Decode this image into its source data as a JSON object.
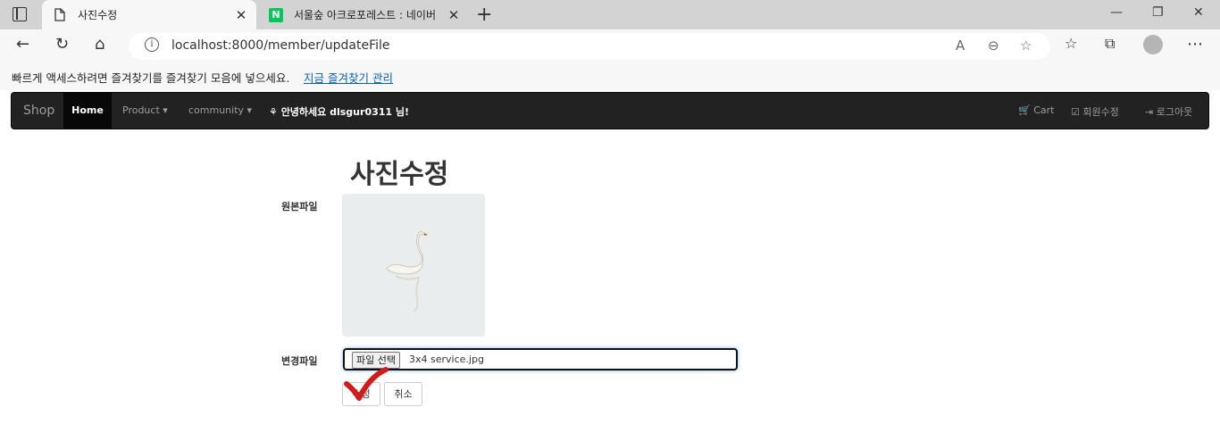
{
  "browser": {
    "tabs": [
      {
        "title": "사진수정",
        "active": true,
        "favicon": "document-icon"
      },
      {
        "title": "서울숲 아크로포레스트 : 네이버",
        "active": false,
        "favicon": "naver-icon",
        "favicon_text": "N"
      }
    ],
    "new_tab": "+",
    "window_controls": {
      "minimize": "—",
      "restore": "❐",
      "close": "✕"
    },
    "url": "localhost:8000/member/updateFile",
    "bookmarks_bar": {
      "message": "빠르게 액세스하려면 즐겨찾기를 즐겨찾기 모음에 넣으세요.",
      "link": "지금 즐겨찾기 관리"
    }
  },
  "navbar": {
    "brand": "Shop",
    "home": "Home",
    "product": "Product ▾",
    "community": "community ▾",
    "greeting": "⚘ 안녕하세요 dlsgur0311 님!",
    "cart": "🛒 Cart",
    "edit_member": "☑ 회원수정",
    "logout": "⇥ 로그아웃"
  },
  "form": {
    "title": "사진수정",
    "original_label": "원본파일",
    "change_label": "변경파일",
    "choose_file_button": "파일 선택",
    "chosen_file": "3x4 service.jpg",
    "submit_button": "수정",
    "cancel_button": "취소"
  },
  "colors": {
    "navbar_bg": "#222222",
    "link": "#0a5db8",
    "annotation_check": "#d01c1c"
  }
}
